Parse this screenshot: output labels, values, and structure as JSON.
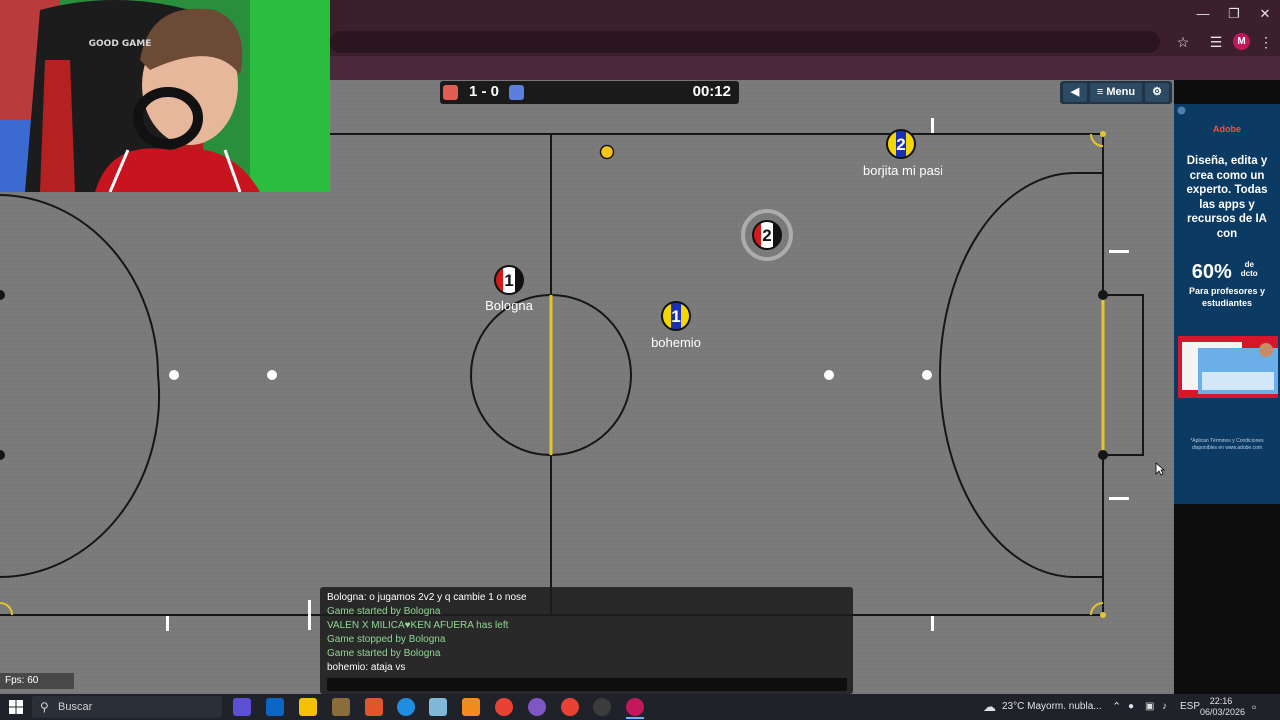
{
  "scoreboard": {
    "score": "1 - 0",
    "time": "00:12",
    "red_color": "#e35d50",
    "blue_color": "#5b7fdc"
  },
  "menu": {
    "back_icon": "back-triangle-icon",
    "label": "Menu",
    "settings_icon": "gear-icon"
  },
  "players": [
    {
      "number": "1",
      "name": "Bologna",
      "team": "red"
    },
    {
      "number": "2",
      "name": "",
      "team": "red"
    },
    {
      "number": "1",
      "name": "bohemio",
      "team": "blue"
    },
    {
      "number": "2",
      "name": "borjita mi pasi",
      "team": "blue"
    }
  ],
  "chat": {
    "lines": [
      {
        "text": "Bologna: o jugamos 2v2 y q cambie 1 o nose",
        "kind": "message",
        "color": "#ffffff"
      },
      {
        "text": "Game started by Bologna",
        "kind": "system",
        "color": "#8fd694"
      },
      {
        "text": "VALEN X MILICA♥KEN AFUERA has left",
        "kind": "system",
        "color": "#8fd694"
      },
      {
        "text": "Game stopped by Bologna",
        "kind": "system",
        "color": "#8fd694"
      },
      {
        "text": "Game started by Bologna",
        "kind": "system",
        "color": "#8fd694"
      },
      {
        "text": "bohemio: ataja vs",
        "kind": "message",
        "color": "#ffffff"
      }
    ]
  },
  "fps": "Fps: 60",
  "webcam": {
    "sign_text": "GOOD GAME"
  },
  "ad": {
    "brand": "Adobe",
    "headline": "Diseña, edita y crea como un experto. Todas las apps y recursos de IA con",
    "discount": "60%",
    "discount_suffix": "de dcto",
    "audience": "Para profesores y estudiantes",
    "footnote": "*Aplican Términos y Condiciones disponibles en www.adobe.com"
  },
  "taskbar": {
    "search_placeholder": "Buscar",
    "weather": "23°C  Mayorm. nubla...",
    "language": "ESP",
    "time": "22:16",
    "date": "06/03/2026"
  }
}
